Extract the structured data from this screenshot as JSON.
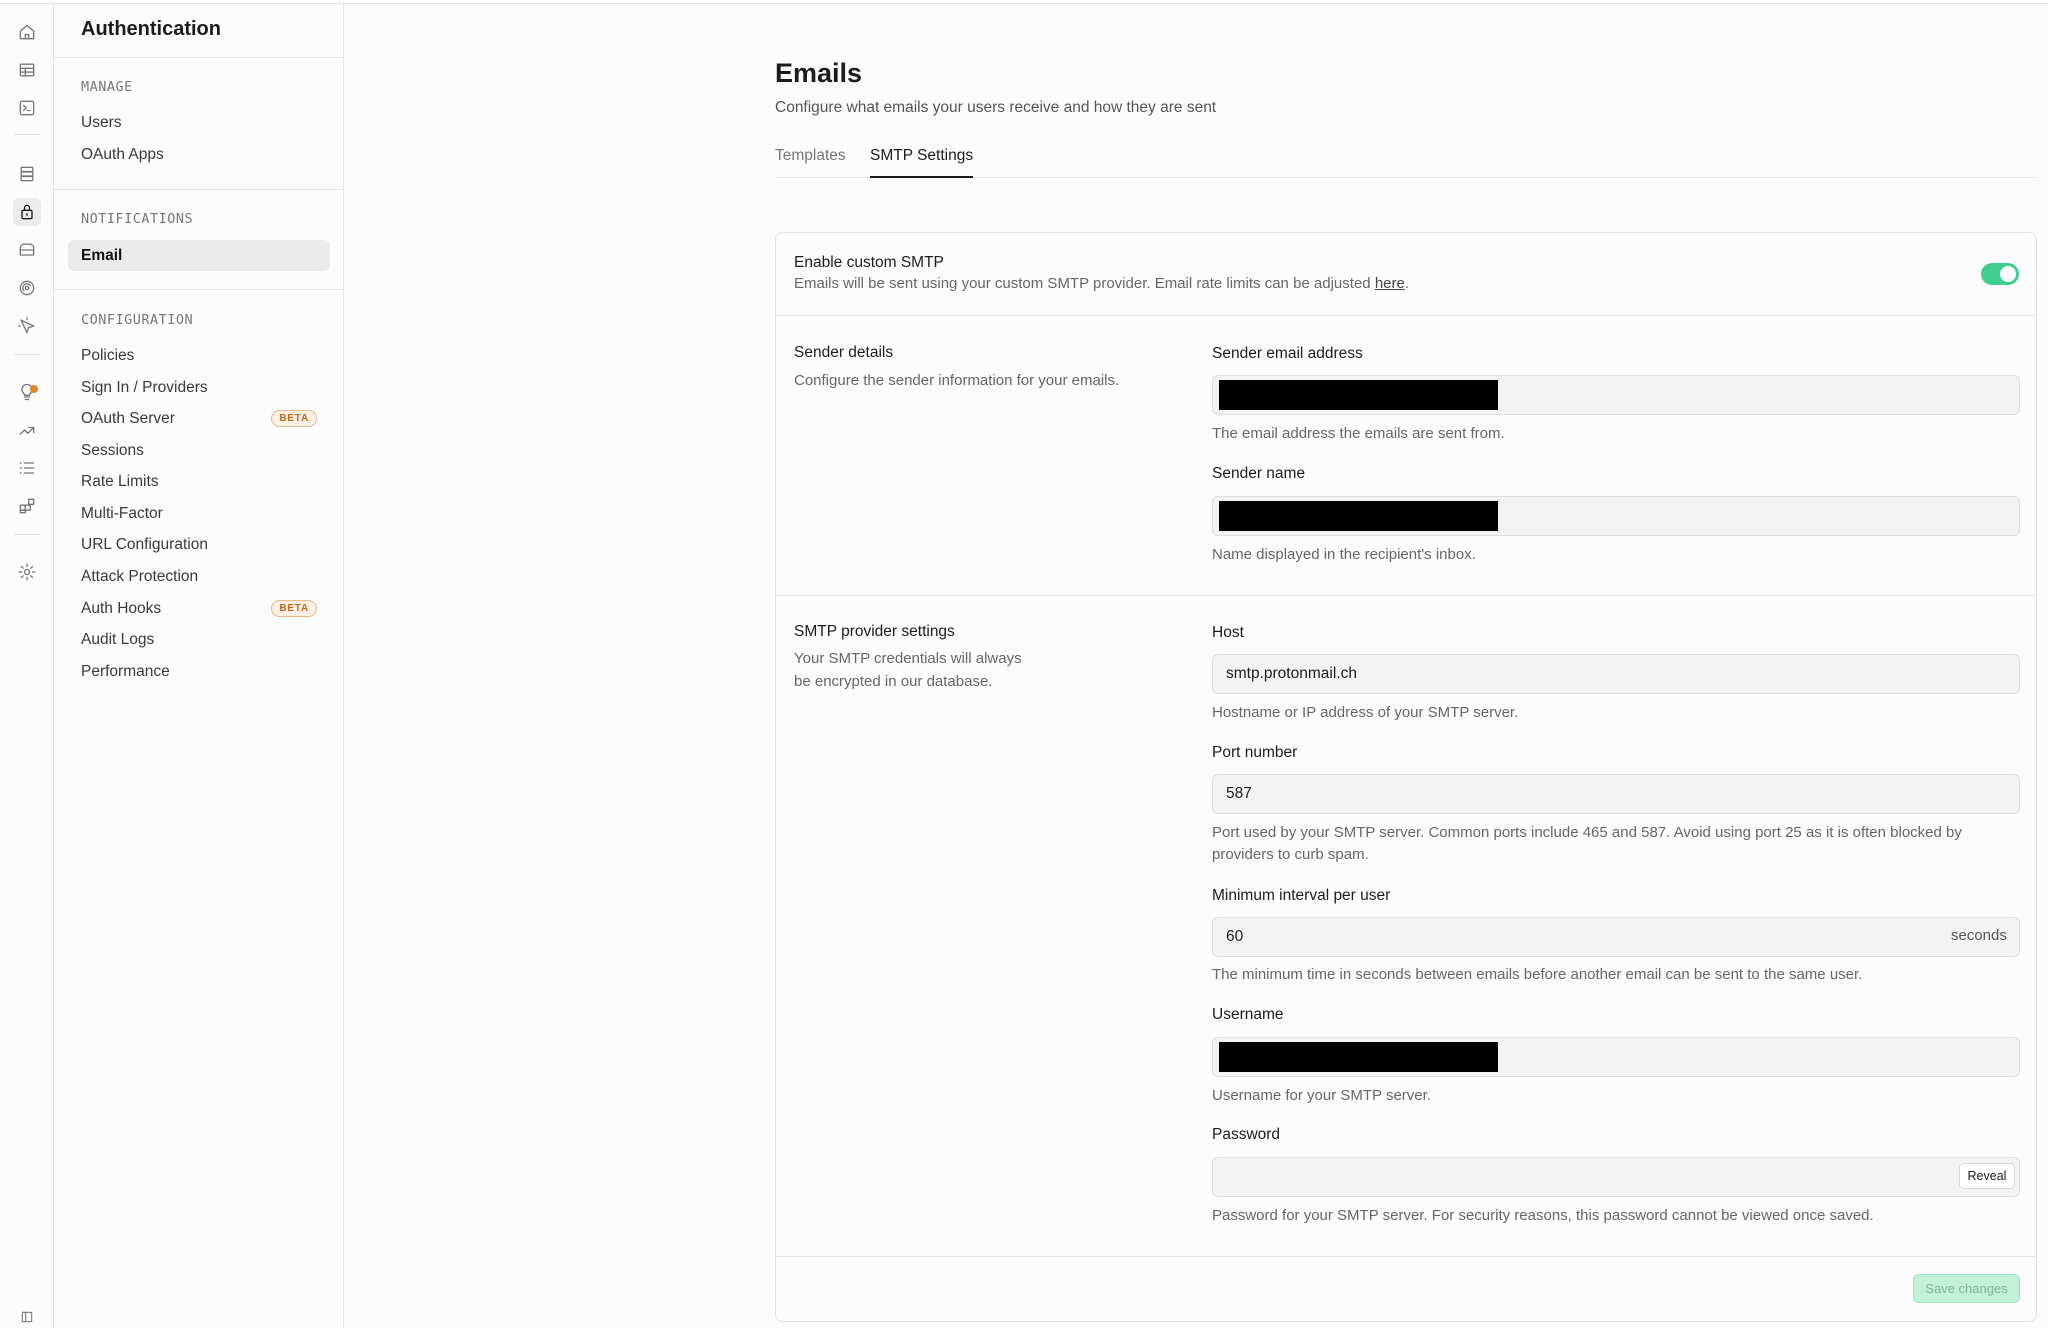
{
  "sidebar": {
    "title": "Authentication",
    "sections": [
      {
        "heading": "MANAGE",
        "items": [
          "Users",
          "OAuth Apps"
        ]
      },
      {
        "heading": "NOTIFICATIONS",
        "items": [
          "Email"
        ]
      },
      {
        "heading": "CONFIGURATION",
        "items": [
          "Policies",
          "Sign In / Providers",
          "OAuth Server",
          "Sessions",
          "Rate Limits",
          "Multi-Factor",
          "URL Configuration",
          "Attack Protection",
          "Auth Hooks",
          "Audit Logs",
          "Performance"
        ]
      }
    ],
    "active_item": "Email",
    "badge_label": "BETA"
  },
  "rail_icons": [
    "home-icon",
    "table-editor-icon",
    "sql-editor-icon",
    "database-icon",
    "auth-lock-icon",
    "storage-icon",
    "realtime-icon",
    "edge-functions-icon",
    "advisors-icon",
    "reports-icon",
    "logs-icon",
    "integrations-icon",
    "settings-icon",
    "collapse-sidebar-icon"
  ],
  "page": {
    "title": "Emails",
    "description": "Configure what emails your users receive and how they are sent",
    "tabs": [
      "Templates",
      "SMTP Settings"
    ],
    "active_tab": "SMTP Settings"
  },
  "smtp": {
    "enable_title": "Enable custom SMTP",
    "enable_desc": "Emails will be sent using your custom SMTP provider. Email rate limits can be adjusted",
    "enable_link": "here",
    "enabled": true,
    "sender": {
      "title": "Sender details",
      "desc": "Configure the sender information for your emails.",
      "email_label": "Sender email address",
      "email_help": "The email address the emails are sent from.",
      "name_label": "Sender name",
      "name_help": "Name displayed in the recipient's inbox."
    },
    "provider": {
      "title": "SMTP provider settings",
      "desc_line1": "Your SMTP credentials will always",
      "desc_line2": "be encrypted in our database.",
      "host_label": "Host",
      "host_value": "smtp.protonmail.ch",
      "host_help": "Hostname or IP address of your SMTP server.",
      "port_label": "Port number",
      "port_value": "587",
      "port_help": "Port used by your SMTP server. Common ports include 465 and 587. Avoid using port 25 as it is often blocked by providers to curb spam.",
      "interval_label": "Minimum interval per user",
      "interval_value": "60",
      "interval_suffix": "seconds",
      "interval_help": "The minimum time in seconds between emails before another email can be sent to the same user.",
      "username_label": "Username",
      "username_help": "Username for your SMTP server.",
      "password_label": "Password",
      "password_reveal": "Reveal",
      "password_help": "Password for your SMTP server. For security reasons, this password cannot be viewed once saved."
    },
    "save_label": "Save changes"
  },
  "colors": {
    "accent": "#3ecf8e",
    "beta": "#c26a1f",
    "notify_dot": "#e2832f"
  }
}
